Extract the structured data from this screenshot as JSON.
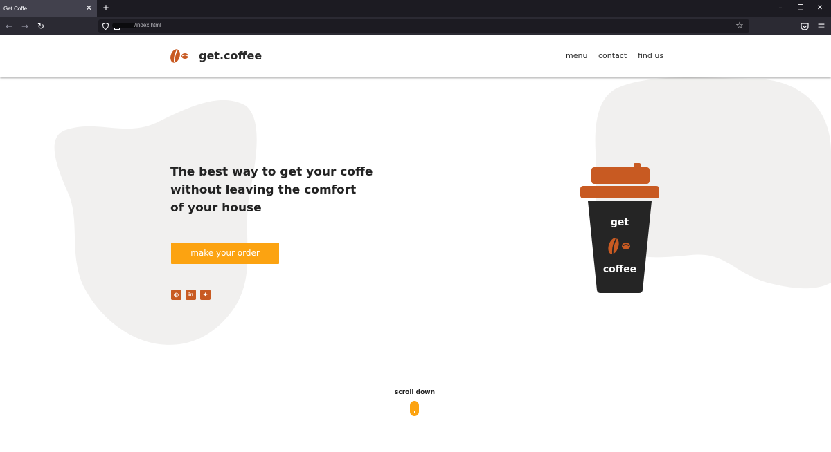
{
  "browser": {
    "tab_title": "Get Coffe",
    "tab_close": "✕",
    "new_tab": "+",
    "url": "/index.html",
    "window_controls": {
      "minimize": "–",
      "restore": "❐",
      "close": "✕"
    },
    "nav": {
      "back": "←",
      "forward": "→",
      "reload": "↻",
      "bookmark": "☆",
      "menu": "≡"
    }
  },
  "header": {
    "brand": "get.coffee",
    "nav": [
      "menu",
      "contact",
      "find us"
    ]
  },
  "hero": {
    "headline_lines": [
      "The best way to get your coffe",
      "without leaving the comfort",
      "of your house"
    ],
    "cta": "make your order",
    "social": [
      {
        "icon": "instagram-icon",
        "glyph": "◎"
      },
      {
        "icon": "linkedin-icon",
        "glyph": "in"
      },
      {
        "icon": "twitter-icon",
        "glyph": "✦"
      }
    ]
  },
  "cup": {
    "top": "get",
    "bottom": "coffee"
  },
  "scroll": {
    "label": "scroll down"
  },
  "colors": {
    "accent": "#fca311",
    "brand_orange": "#c85a22",
    "cup_dark": "#252525",
    "blob": "#f1f0ef",
    "text": "#222222"
  }
}
